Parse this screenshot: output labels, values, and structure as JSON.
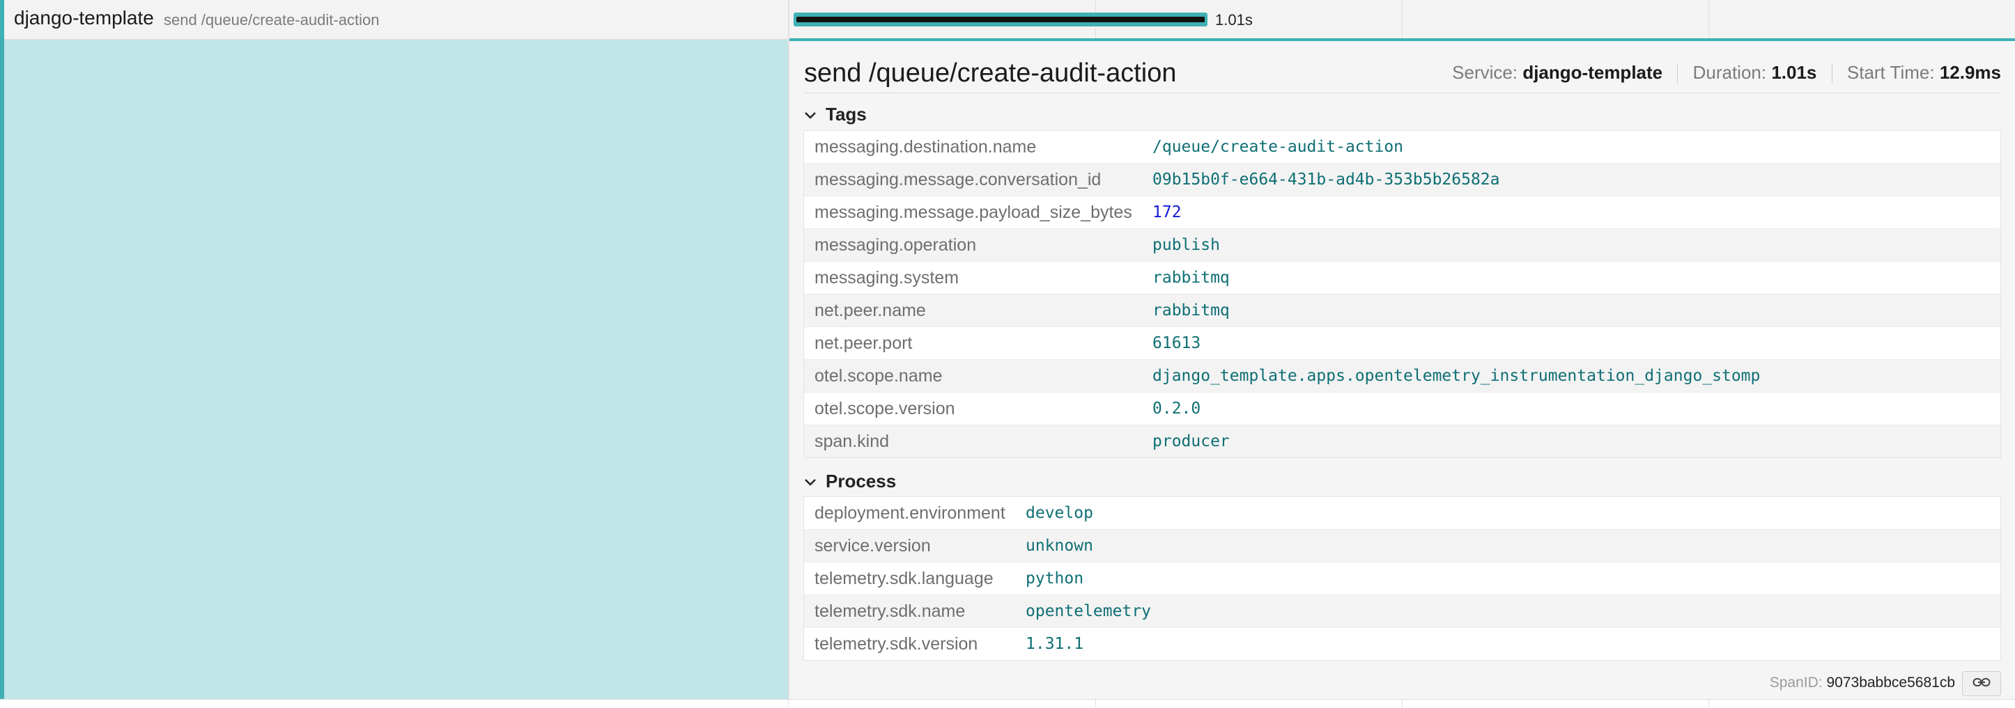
{
  "span_row": {
    "service": "django-template",
    "operation": "send /queue/create-audit-action",
    "duration": "1.01s",
    "progress_fraction": 1.0
  },
  "detail": {
    "title": "send /queue/create-audit-action",
    "service_label": "Service:",
    "service_value": "django-template",
    "duration_label": "Duration:",
    "duration_value": "1.01s",
    "start_label": "Start Time:",
    "start_value": "12.9ms",
    "tags_heading": "Tags",
    "tags": [
      {
        "key": "messaging.destination.name",
        "value": "/queue/create-audit-action"
      },
      {
        "key": "messaging.message.conversation_id",
        "value": "09b15b0f-e664-431b-ad4b-353b5b26582a"
      },
      {
        "key": "messaging.message.payload_size_bytes",
        "value": "172"
      },
      {
        "key": "messaging.operation",
        "value": "publish"
      },
      {
        "key": "messaging.system",
        "value": "rabbitmq"
      },
      {
        "key": "net.peer.name",
        "value": "rabbitmq"
      },
      {
        "key": "net.peer.port",
        "value": "61613"
      },
      {
        "key": "otel.scope.name",
        "value": "django_template.apps.opentelemetry_instrumentation_django_stomp"
      },
      {
        "key": "otel.scope.version",
        "value": "0.2.0"
      },
      {
        "key": "span.kind",
        "value": "producer"
      }
    ],
    "process_heading": "Process",
    "process": [
      {
        "key": "deployment.environment",
        "value": "develop"
      },
      {
        "key": "service.version",
        "value": "unknown"
      },
      {
        "key": "telemetry.sdk.language",
        "value": "python"
      },
      {
        "key": "telemetry.sdk.name",
        "value": "opentelemetry"
      },
      {
        "key": "telemetry.sdk.version",
        "value": "1.31.1"
      }
    ],
    "span_id_label": "SpanID:",
    "span_id_value": "9073babbce5681cb"
  },
  "icons": {
    "section_toggle": "chevron-down-icon",
    "copy_link": "link-icon"
  },
  "colors": {
    "accent": "#3eb0b4",
    "left_panel": "#c2e5e7",
    "value_text": "#0f6f74",
    "number_text": "#1419d8"
  }
}
